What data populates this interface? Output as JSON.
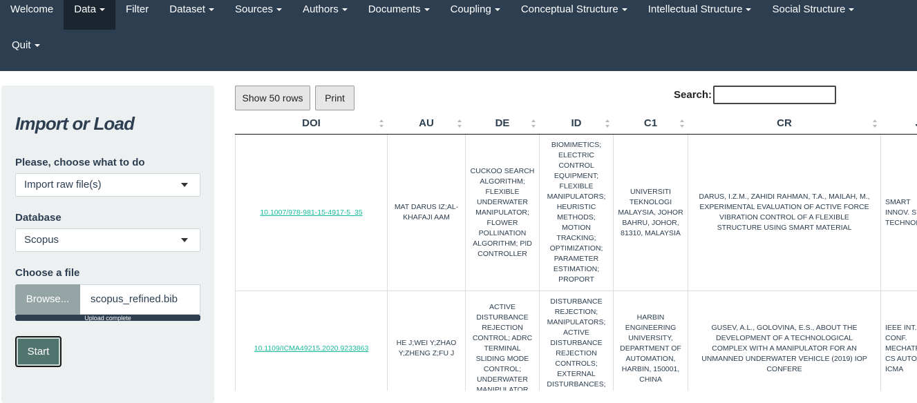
{
  "navbar": {
    "items": [
      {
        "label": "Welcome",
        "dropdown": false,
        "active": false
      },
      {
        "label": "Data",
        "dropdown": true,
        "active": true
      },
      {
        "label": "Filter",
        "dropdown": false,
        "active": false
      },
      {
        "label": "Dataset",
        "dropdown": true,
        "active": false
      },
      {
        "label": "Sources",
        "dropdown": true,
        "active": false
      },
      {
        "label": "Authors",
        "dropdown": true,
        "active": false
      },
      {
        "label": "Documents",
        "dropdown": true,
        "active": false
      },
      {
        "label": "Coupling",
        "dropdown": true,
        "active": false
      },
      {
        "label": "Conceptual Structure",
        "dropdown": true,
        "active": false
      },
      {
        "label": "Intellectual Structure",
        "dropdown": true,
        "active": false
      },
      {
        "label": "Social Structure",
        "dropdown": true,
        "active": false
      }
    ],
    "quit_label": "Quit"
  },
  "sidebar": {
    "title": "Import or Load",
    "choose_label": "Please, choose what to do",
    "choose_value": "Import raw file(s)",
    "database_label": "Database",
    "database_value": "Scopus",
    "file_label": "Choose a file",
    "browse_label": "Browse...",
    "file_name": "scopus_refined.bib",
    "upload_status": "Upload complete",
    "start_label": "Start"
  },
  "toolbar": {
    "show_rows_label": "Show 50 rows",
    "print_label": "Print",
    "search_label": "Search:"
  },
  "table": {
    "headers": [
      "DOI",
      "AU",
      "DE",
      "ID",
      "C1",
      "CR",
      "JI"
    ],
    "rows": [
      {
        "doi": "10.1007/978-981-15-4917-5_35",
        "au": "MAT DARUS IZ;AL-KHAFAJI AAM",
        "de": "CUCKOO SEARCH ALGORITHM; FLEXIBLE UNDERWATER MANIPULATOR; FLOWER POLLINATION ALGORITHM; PID CONTROLLER",
        "id": "BIOMIMETICS; ELECTRIC CONTROL EQUIPMENT; FLEXIBLE MANIPULATORS; HEURISTIC METHODS; MOTION TRACKING; OPTIMIZATION; PARAMETER ESTIMATION; PROPORT",
        "c1": "UNIVERSITI TEKNOLOGI MALAYSIA, JOHOR BAHRU, JOHOR, 81310, MALAYSIA",
        "cr": "DARUS, I.Z.M., ZAHIDI RAHMAN, T.A., MAILAH, M., EXPERIMENTAL EVALUATION OF ACTIVE FORCE VIBRATION CONTROL OF A FLEXIBLE STRUCTURE USING SMART MATERIAL",
        "ji": "SMART INNOV. SYST. TECHNOL."
      },
      {
        "doi": "10.1109/ICMA49215.2020.9233863",
        "au": "HE J;WEI Y;ZHAO Y;ZHENG Z;FU J",
        "de": "ACTIVE DISTURBANCE REJECTION CONTROL; ADRC TERMINAL SLIDING MODE CONTROL; UNDERWATER MANIPULATOR",
        "id": "DISTURBANCE REJECTION; MANIPULATORS; ACTIVE DISTURBANCE REJECTION CONTROLS; EXTERNAL DISTURBANCES; FLOW",
        "c1": "HARBIN ENGINEERING UNIVERSITY, DEPARTMENT OF AUTOMATION, HARBIN, 150001, CHINA",
        "cr": "GUSEV, A.L., GOLOVINA, E.S., ABOUT THE DEVELOPMENT OF A TECHNOLOGICAL COMPLEX WITH A MANIPULATOR FOR AN UNMANNED UNDERWATER VEHICLE (2019) IOP CONFERE",
        "ji": "IEEE INT. CONF. MECHATRONICS AUTOM., ICMA"
      }
    ]
  }
}
